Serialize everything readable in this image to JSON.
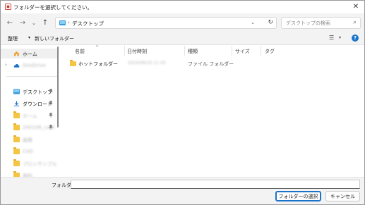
{
  "window": {
    "title": "フォルダーを選択してください。",
    "close_glyph": "✕"
  },
  "nav": {
    "back_glyph": "←",
    "forward_glyph": "→",
    "recent_glyph": "⌄",
    "up_glyph": "↑",
    "address": {
      "separator": "›",
      "path": "デスクトップ",
      "dropdown_glyph": "⌄",
      "refresh_glyph": "↻"
    },
    "search": {
      "placeholder": "デスクトップの検索",
      "icon_glyph": "⌕"
    }
  },
  "commands": {
    "organize": "整理",
    "organize_caret": "▾",
    "new_folder": "新しいフォルダー",
    "view_glyph": "☰",
    "view_caret": "▾",
    "help_glyph": "?"
  },
  "sidebar": {
    "home": {
      "label": "ホーム"
    },
    "onedrive": {
      "label": "OneDrive",
      "expand_glyph": "›"
    },
    "pin_glyph": "📌",
    "quick": [
      {
        "label": "デスクトップ",
        "pinned": true
      },
      {
        "label": "ダウンロード",
        "pinned": true
      },
      {
        "label": "ホーム",
        "pinned": true
      },
      {
        "label": "240106_capt",
        "pinned": true
      },
      {
        "label": "画像",
        "pinned": false
      },
      {
        "label": "CAD",
        "pinned": false
      },
      {
        "label": "プロンサンプル",
        "pinned": false
      },
      {
        "label": "資料",
        "pinned": false
      }
    ]
  },
  "list": {
    "columns": {
      "name": "名前",
      "date": "日付時刻",
      "type": "種類",
      "size": "サイズ",
      "tag": "タグ"
    },
    "sort_glyph": "^",
    "rows": [
      {
        "name": "ホットフォルダー",
        "date": "2024/06/10 11:45",
        "type": "ファイル フォルダー"
      }
    ]
  },
  "footer": {
    "folder_label": "フォルダー:",
    "folder_value": "",
    "select_button": "フォルダーの選択",
    "cancel_button": "キャンセル"
  },
  "colors": {
    "accent": "#1a73c9",
    "folder": "#f4c542",
    "desktop_icon": "#3a9ad9"
  }
}
